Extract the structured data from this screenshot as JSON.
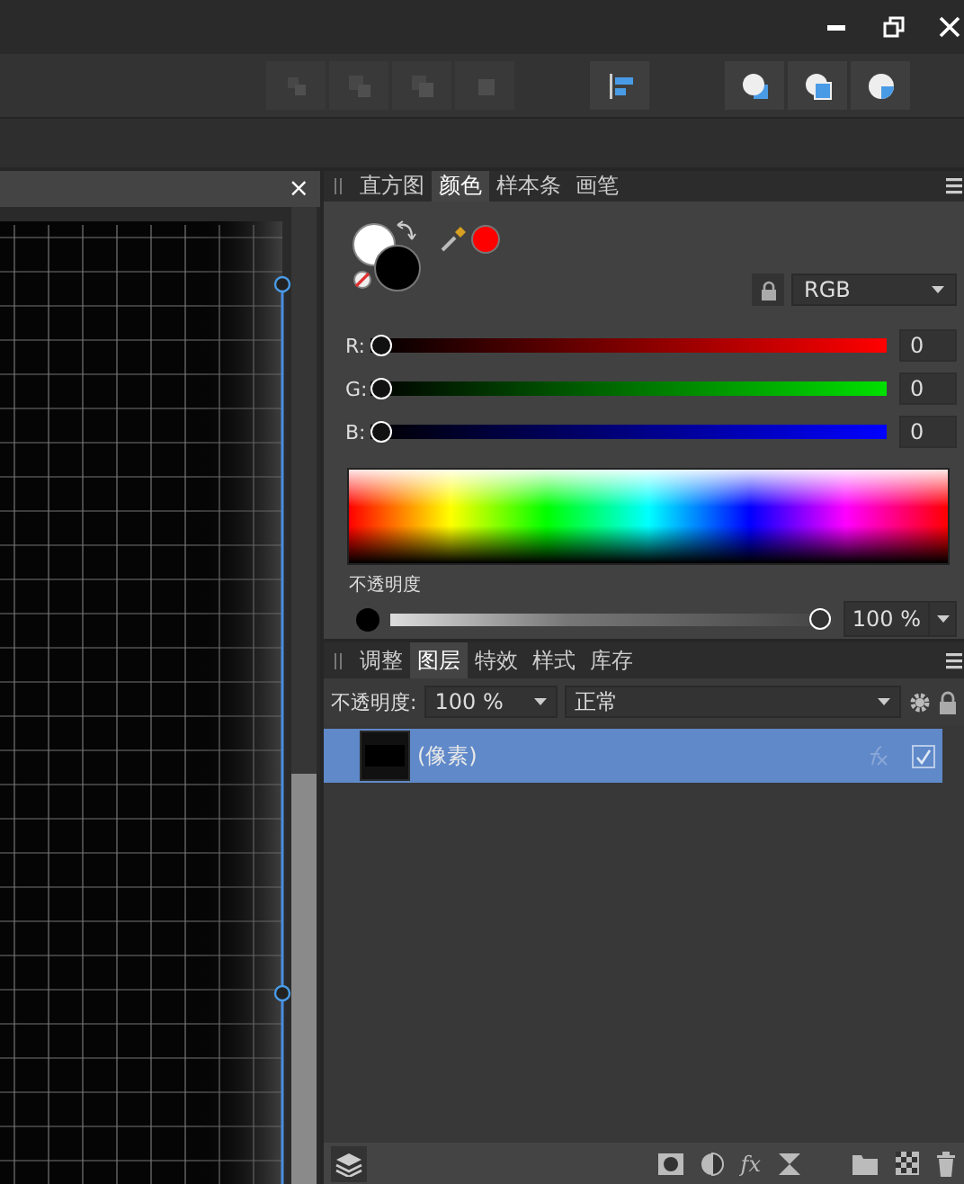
{
  "toolbar": {
    "groups": [
      {
        "buttons": [
          {
            "kind": "bring-front",
            "disabled": true
          },
          {
            "kind": "forward",
            "disabled": true
          },
          {
            "kind": "backward",
            "disabled": true
          },
          {
            "kind": "send-back",
            "disabled": true
          }
        ]
      },
      {
        "buttons": [
          {
            "kind": "align-left",
            "disabled": false
          }
        ]
      },
      {
        "buttons": [
          {
            "kind": "add",
            "disabled": false
          },
          {
            "kind": "subtract",
            "disabled": false
          },
          {
            "kind": "intersect",
            "disabled": false
          }
        ]
      }
    ]
  },
  "document_tab": {
    "close": "×"
  },
  "color_panel": {
    "tabs": [
      {
        "label": "直方图",
        "selected": false
      },
      {
        "label": "颜色",
        "selected": true
      },
      {
        "label": "样本条",
        "selected": false
      },
      {
        "label": "画笔",
        "selected": false
      }
    ],
    "wells": [
      {
        "kind": "fill",
        "color": "#ffffff"
      },
      {
        "kind": "stroke",
        "color": "#000000"
      }
    ],
    "swatch": {
      "color": "#ff0000"
    },
    "model": "RGB",
    "channels": [
      {
        "label": "R:",
        "value": "0",
        "level": 0,
        "color": "#ff0000"
      },
      {
        "label": "G:",
        "value": "0",
        "level": 0,
        "color": "#00e000"
      },
      {
        "label": "B:",
        "value": "0",
        "level": 0,
        "color": "#0000ff"
      }
    ],
    "opacity": {
      "label": "不透明度",
      "level": 1,
      "value": "100 %"
    }
  },
  "layers_panel": {
    "tabs": [
      {
        "label": "调整",
        "selected": false
      },
      {
        "label": "图层",
        "selected": true
      },
      {
        "label": "特效",
        "selected": false
      },
      {
        "label": "样式",
        "selected": false
      },
      {
        "label": "库存",
        "selected": false
      }
    ],
    "opacity_label": "不透明度:",
    "opacity_value": "100 %",
    "blend_mode": "正常",
    "layers": [
      {
        "name": "(像素)",
        "selected": true,
        "visible": true
      }
    ],
    "bottom_bar": {
      "effects": "fx"
    }
  }
}
